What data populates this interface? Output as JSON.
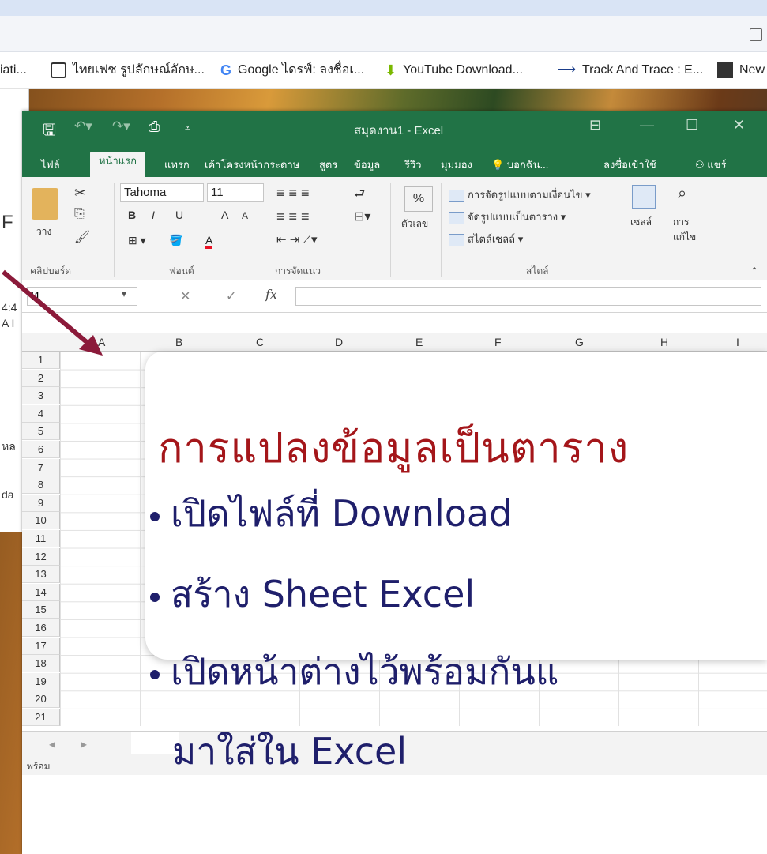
{
  "browser": {
    "bookmarks": [
      {
        "label": "iati...",
        "icon": "bookmark-icon"
      },
      {
        "label": "ไทยเฟซ รูปลักษณ์อักษ...",
        "icon": "thaiface-icon"
      },
      {
        "label": "Google ไดรฟ์: ลงชื่อเ...",
        "icon": "google-icon"
      },
      {
        "label": "YouTube Download...",
        "icon": "download-icon"
      },
      {
        "label": "Track And Trace : E...",
        "icon": "track-icon"
      },
      {
        "label": "New",
        "icon": "news-icon"
      }
    ]
  },
  "background_window": {
    "letters": [
      "F",
      "i",
      "4:4",
      "A I",
      "หล",
      "da"
    ]
  },
  "excel": {
    "window_title": "สมุดงาน1 - Excel",
    "tabs": [
      "ไฟล์",
      "หน้าแรก",
      "แทรก",
      "เค้าโครงหน้ากระดาษ",
      "สูตร",
      "ข้อมูล",
      "รีวิว",
      "มุมมอง",
      "บอกฉัน...",
      "ลงชื่อเข้าใช้",
      "แชร์"
    ],
    "active_tab": "หน้าแรก",
    "ribbon": {
      "paste_label": "วาง",
      "clipboard_group": "คลิปบอร์ด",
      "font_name": "Tahoma",
      "font_size": "11",
      "bold": "B",
      "italic": "I",
      "underline": "U",
      "grow_font": "A",
      "shrink_font": "A",
      "font_color": "A",
      "font_group": "ฟอนต์",
      "alignment_group": "การจัดแนว",
      "percent": "%",
      "number_label": "ตัวเลข",
      "cond_format": "การจัดรูปแบบตามเงื่อนไข",
      "format_table": "จัดรูปแบบเป็นตาราง",
      "cell_styles": "สไตล์เซลล์",
      "styles_group": "สไตล์",
      "cells_label": "เซลล์",
      "editing_label": "การ แก้ไข"
    },
    "name_box": "I1",
    "fx": "fx",
    "columns": [
      "A",
      "B",
      "C",
      "D",
      "E",
      "F",
      "G",
      "H",
      "I"
    ],
    "rows": [
      "1",
      "2",
      "3",
      "4",
      "5",
      "6",
      "7",
      "8",
      "9",
      "10",
      "11",
      "12",
      "13",
      "14",
      "15",
      "16",
      "17",
      "18",
      "19",
      "20",
      "21"
    ],
    "status": "พร้อม"
  },
  "slide": {
    "title": "การแปลงข้อมูลเป็นตาราง",
    "bullets": [
      "เปิดไฟล์ที่ Download",
      "สร้าง Sheet Excel",
      "เปิดหน้าต่างไว้พร้อมกันแ"
    ],
    "continuation": "มาใส่ใน Excel",
    "title_color": "#a4161a",
    "text_color": "#1f1f6b"
  },
  "colors": {
    "excel_green": "#217346",
    "arrow": "#8b1a3a"
  }
}
